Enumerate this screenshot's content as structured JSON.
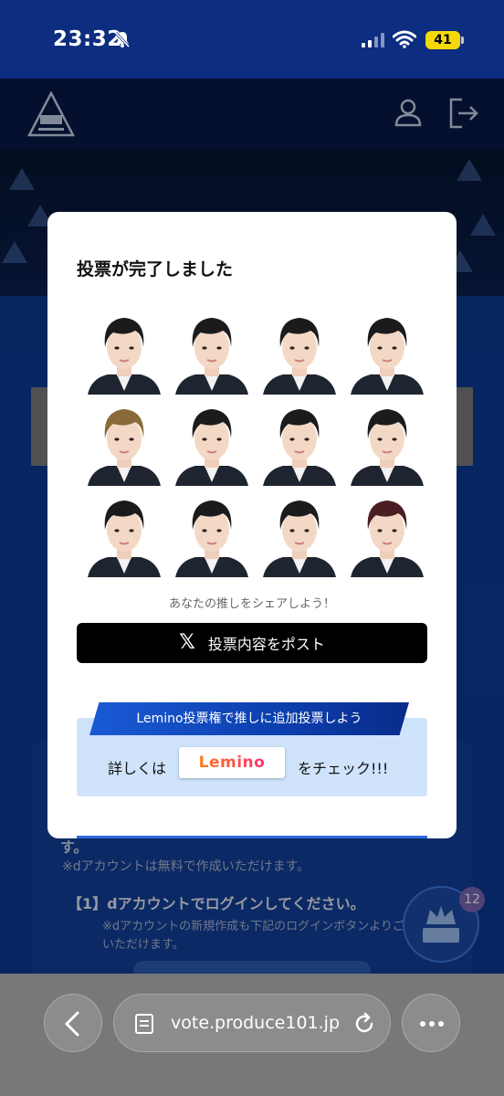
{
  "status_bar": {
    "time": "23:32",
    "battery": "41"
  },
  "modal": {
    "title": "投票が完了しました",
    "share_caption": "あなたの推しをシェアしよう！",
    "post_button_label": "投票内容をポスト",
    "post_button_icon": "x-logo",
    "lemino": {
      "banner": "Lemino投票権で推しに追加投票しよう",
      "left_text": "詳しくは",
      "logo_text": "Lemino",
      "right_text": "をチェック!!!"
    },
    "portraits": [
      {
        "hair": "#1b1b1d"
      },
      {
        "hair": "#1b1b1d"
      },
      {
        "hair": "#1b1b1d"
      },
      {
        "hair": "#1b1b1d"
      },
      {
        "hair": "#8a6a3a"
      },
      {
        "hair": "#1b1b1d"
      },
      {
        "hair": "#1b1b1d"
      },
      {
        "hair": "#1b1b1d"
      },
      {
        "hair": "#1b1b1d"
      },
      {
        "hair": "#1b1b1d"
      },
      {
        "hair": "#1b1b1d"
      },
      {
        "hair": "#4a1e22"
      }
    ]
  },
  "background_page": {
    "su": "す。",
    "note": "※dアカウントは無料で作成いただけます。",
    "step": "【1】dアカウントでログインしてください。",
    "sub1": "※dアカウントの新規作成も下記のログインボタンよりご",
    "sub2": "いただけます。",
    "fab_badge": "12"
  },
  "browser": {
    "url": "vote.produce101.jp"
  }
}
